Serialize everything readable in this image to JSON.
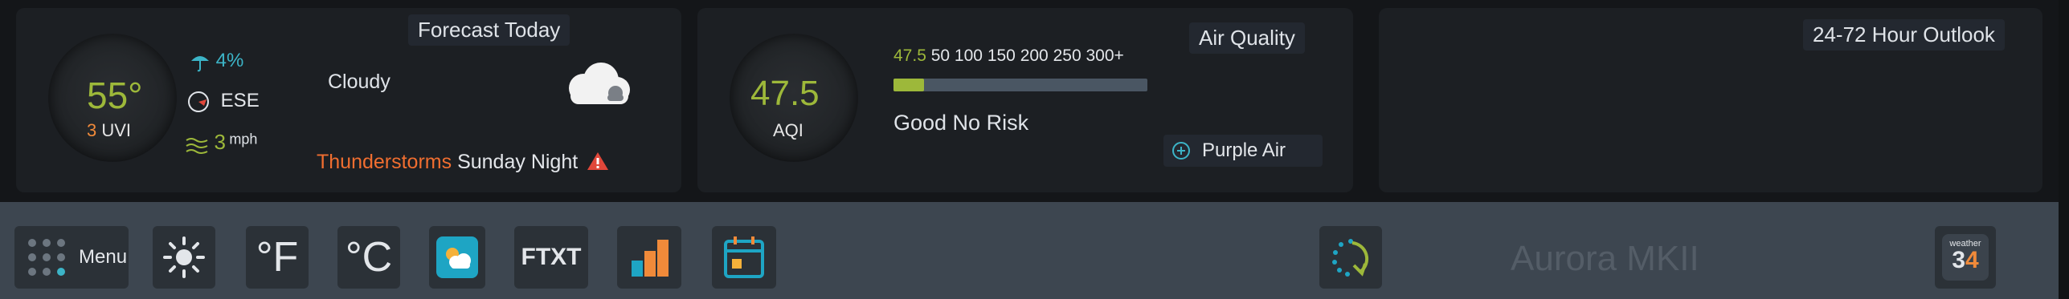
{
  "weather": {
    "panel_title": "Forecast Today",
    "temperature": "55°",
    "uvi_value": "3",
    "uvi_label": "UVI",
    "rain_chance": "4%",
    "wind_direction": "ESE",
    "wind_speed": "3",
    "wind_unit": "mph",
    "condition": "Cloudy",
    "alert_type": "Thunderstorms",
    "alert_when": "Sunday Night"
  },
  "air_quality": {
    "panel_title": "Air Quality",
    "value": "47.5",
    "label": "AQI",
    "scale_current": "47.5",
    "scale_ticks": [
      "50",
      "100",
      "150",
      "200",
      "250",
      "300+"
    ],
    "bar_fill_fraction": 0.12,
    "status": "Good No Risk",
    "source_label": "Purple Air"
  },
  "outlook": {
    "panel_title": "24-72 Hour Outlook"
  },
  "toolbar": {
    "menu_label": "Menu",
    "fahrenheit_label": "°F",
    "celsius_label": "°C",
    "ftxt_label": "FTXT",
    "brand_text": "Aurora MKII",
    "logo_top": "weather",
    "logo_num_a": "3",
    "logo_num_b": "4"
  },
  "colors": {
    "accent_green": "#9db83a",
    "accent_orange": "#f08a3a",
    "accent_teal": "#3cb4c7",
    "alert_red": "#e0473a"
  }
}
